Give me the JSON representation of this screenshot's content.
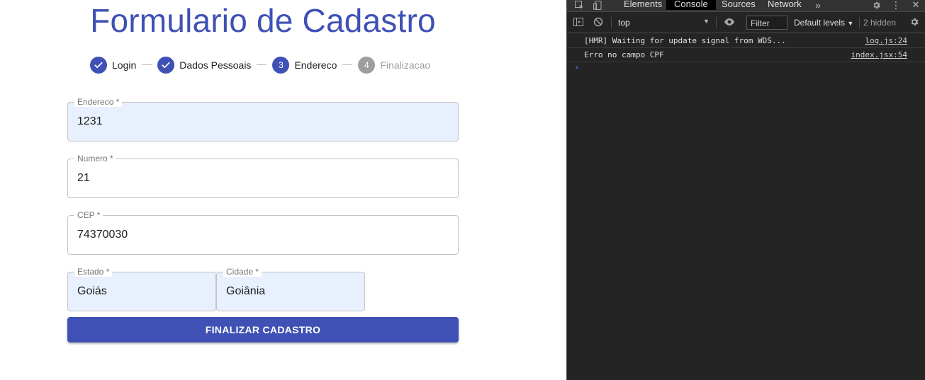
{
  "form": {
    "title": "Formulario de Cadastro",
    "steps": [
      {
        "label": "Login",
        "state": "completed"
      },
      {
        "label": "Dados Pessoais",
        "state": "completed"
      },
      {
        "label": "Endereco",
        "state": "active",
        "number": "3"
      },
      {
        "label": "Finalizacao",
        "state": "inactive",
        "number": "4"
      }
    ],
    "fields": {
      "endereco": {
        "label": "Endereco *",
        "value": "1231"
      },
      "numero": {
        "label": "Numero *",
        "value": "21"
      },
      "cep": {
        "label": "CEP *",
        "value": "74370030"
      },
      "estado": {
        "label": "Estado *",
        "value": "Goiás"
      },
      "cidade": {
        "label": "Cidade *",
        "value": "Goiânia"
      }
    },
    "submit_label": "FINALIZAR CADASTRO",
    "colors": {
      "primary": "#3f51b5",
      "autofill_bg": "#e8f0fe",
      "inactive_step": "#9e9e9e"
    }
  },
  "devtools": {
    "tabs": [
      "Elements",
      "Console",
      "Sources",
      "Network"
    ],
    "active_tab": "Console",
    "more_tabs_icon": "chevrons-right-icon",
    "context": "top",
    "filter_placeholder": "Filter",
    "levels": "Default levels",
    "hidden": "2 hidden",
    "logs": [
      {
        "message": "[HMR] Waiting for update signal from WDS...",
        "source": "log.js:24"
      },
      {
        "message": "Erro no campo CPF",
        "source": "index.jsx:54"
      }
    ],
    "prompt": "›"
  }
}
